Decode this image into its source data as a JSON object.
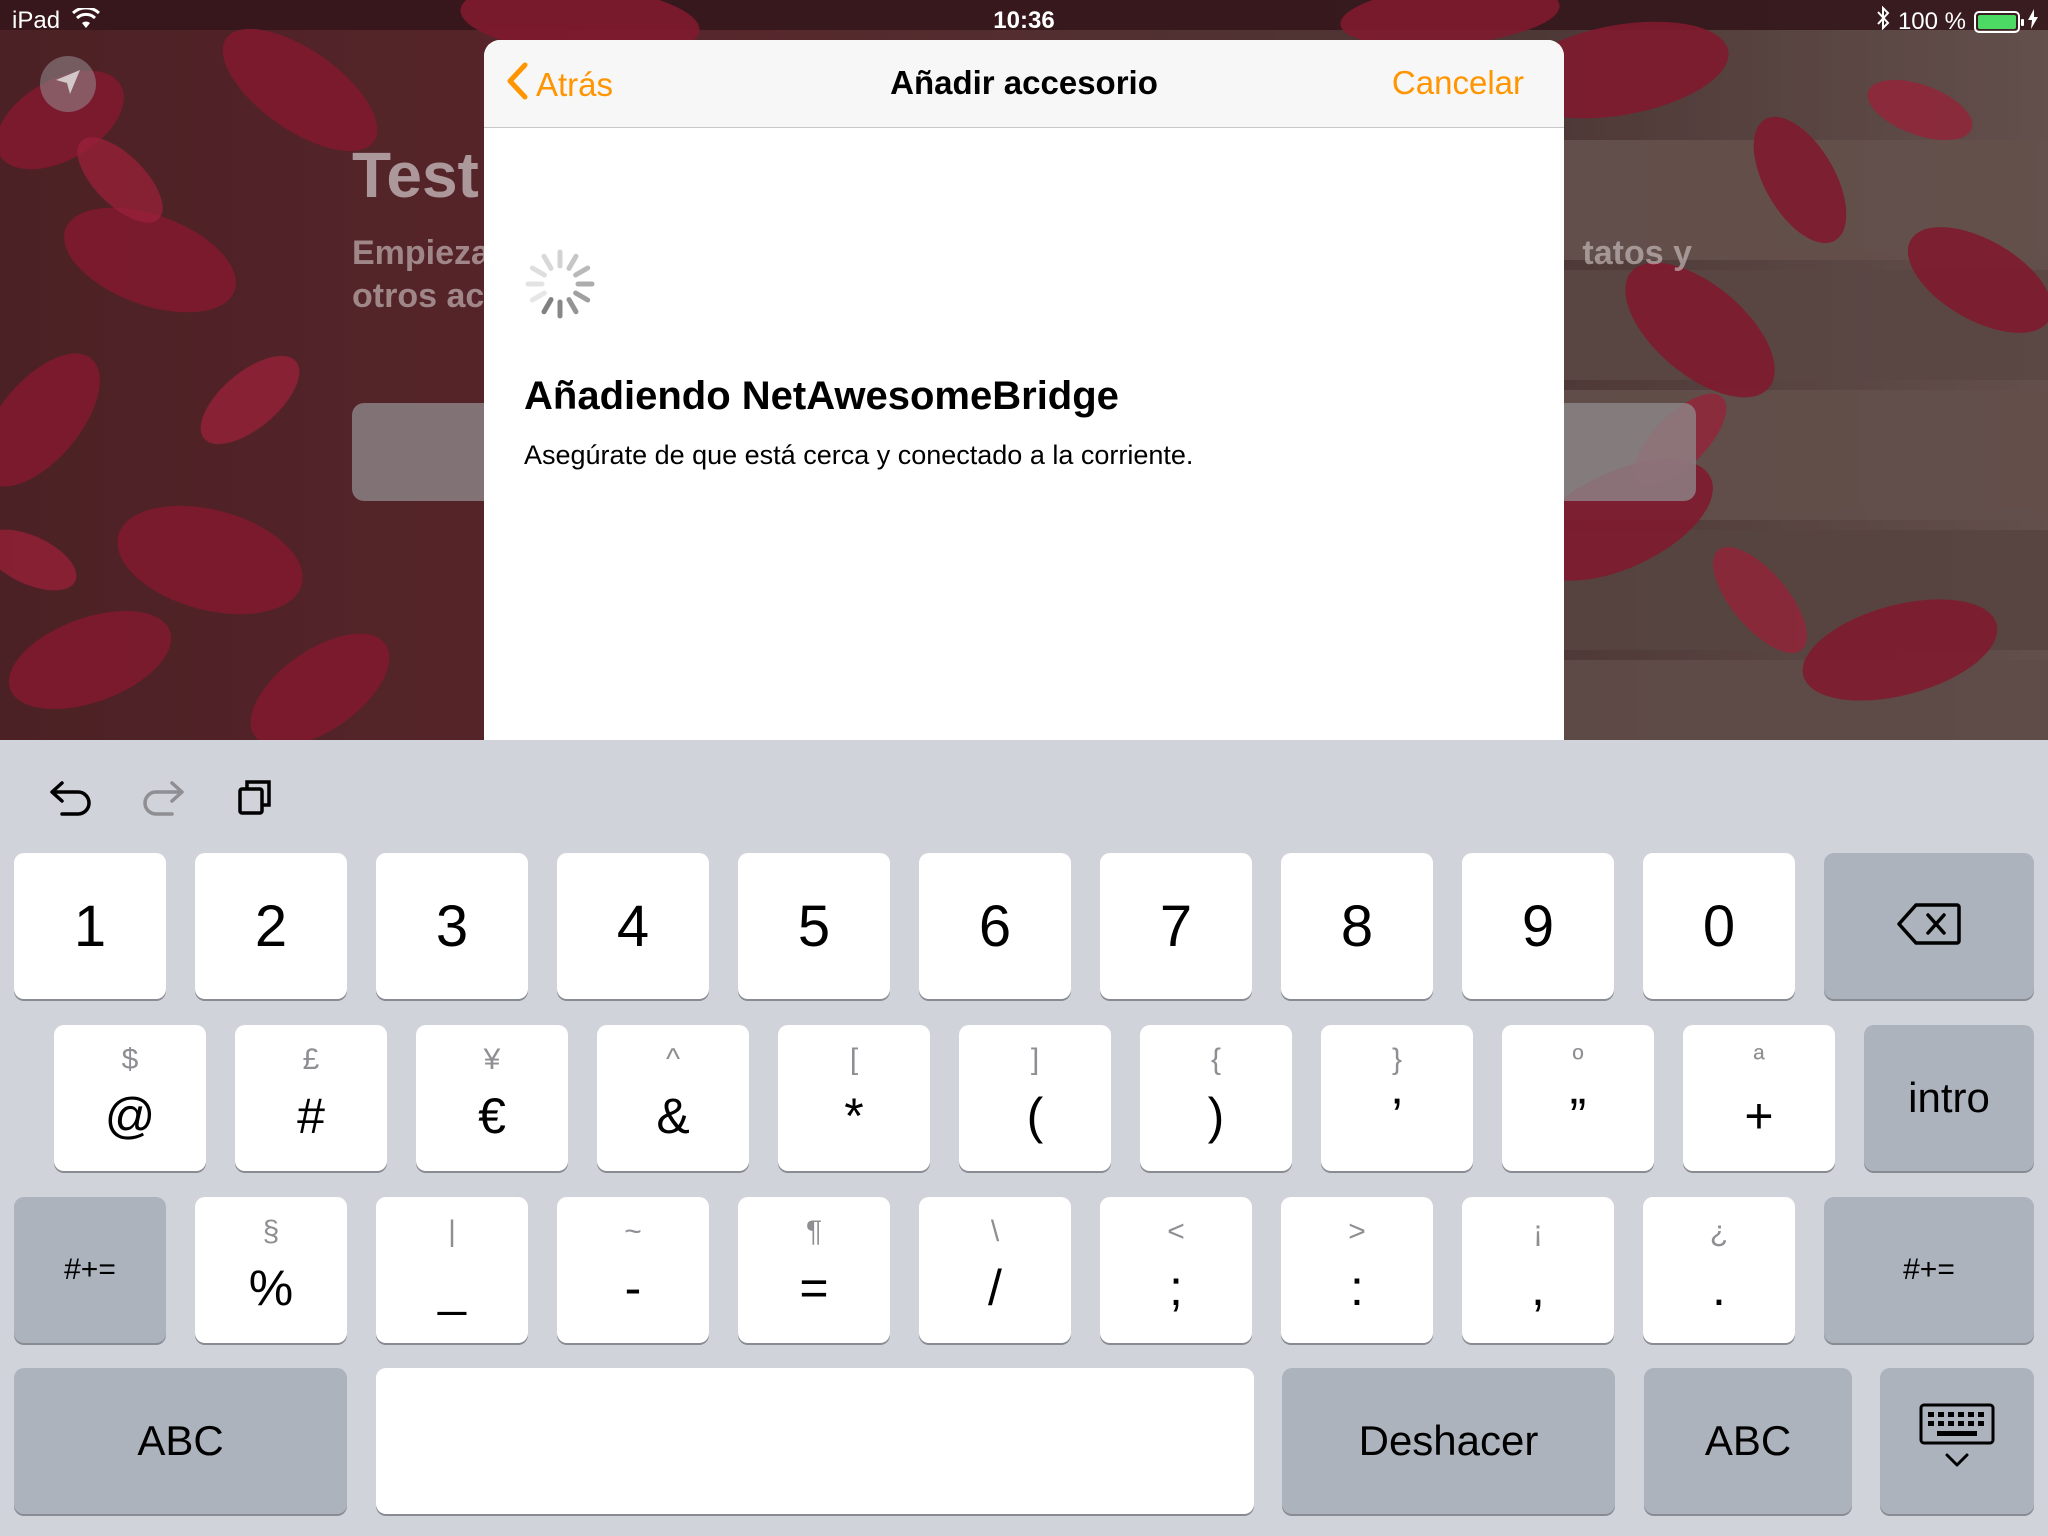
{
  "status_bar": {
    "device": "iPad",
    "time": "10:36",
    "battery": "100 %",
    "battery_level": 1.0
  },
  "background_app": {
    "title": "Test",
    "description": "Empieza… tatos y otros ac…",
    "description_left_line1": "Empieza",
    "description_left_line2": "otros ac",
    "description_right_line1": "tatos y"
  },
  "sheet": {
    "back_label": "Atrás",
    "title": "Añadir accesorio",
    "cancel_label": "Cancelar",
    "adding_title": "Añadiendo NetAwesomeBridge",
    "adding_subtitle": "Asegúrate de que está cerca y conectado a la corriente."
  },
  "accent_color": "#ff9500",
  "keyboard": {
    "row1": [
      "1",
      "2",
      "3",
      "4",
      "5",
      "6",
      "7",
      "8",
      "9",
      "0"
    ],
    "row2": [
      {
        "main": "@",
        "alt": "$"
      },
      {
        "main": "#",
        "alt": "£"
      },
      {
        "main": "€",
        "alt": "¥"
      },
      {
        "main": "&",
        "alt": "^"
      },
      {
        "main": "*",
        "alt": "["
      },
      {
        "main": "(",
        "alt": "]"
      },
      {
        "main": ")",
        "alt": "{"
      },
      {
        "main": "’",
        "alt": "}"
      },
      {
        "main": "”",
        "alt": "º"
      },
      {
        "main": "+",
        "alt": "ª"
      }
    ],
    "row3": [
      {
        "main": "%",
        "alt": "§"
      },
      {
        "main": "_",
        "alt": "|"
      },
      {
        "main": "-",
        "alt": "~"
      },
      {
        "main": "=",
        "alt": "¶"
      },
      {
        "main": "/",
        "alt": "\\"
      },
      {
        "main": ";",
        "alt": "<"
      },
      {
        "main": ":",
        "alt": ">"
      },
      {
        "main": ",",
        "alt": "¡"
      },
      {
        "main": ".",
        "alt": "¿"
      }
    ],
    "return_label": "intro",
    "shift_label": "#+=",
    "abc_label": "ABC",
    "undo_label": "Deshacer",
    "icons": {
      "delete": "delete-icon",
      "undo": "undo-icon",
      "redo": "redo-icon",
      "clipboard": "clipboard-icon",
      "dismiss": "keyboard-dismiss-icon"
    }
  }
}
